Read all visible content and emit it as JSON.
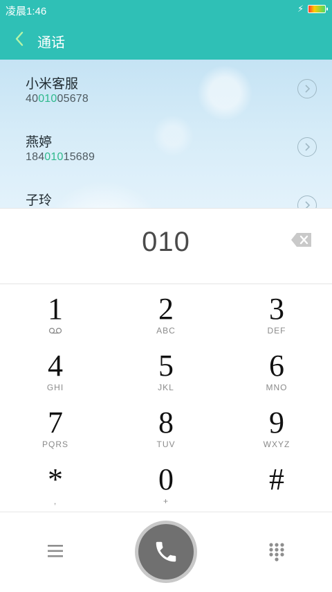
{
  "status": {
    "time": "凌晨1:46",
    "bolt": "⚡"
  },
  "header": {
    "title": "通话"
  },
  "contacts": [
    {
      "name": "小米客服",
      "num_pre": "40",
      "num_match": "010",
      "num_post": "05678"
    },
    {
      "name": "燕婷",
      "num_pre": "184",
      "num_match": "010",
      "num_post": "15689"
    },
    {
      "name": "子玲",
      "num_pre": "",
      "num_match": "",
      "num_post": ""
    }
  ],
  "dialer": {
    "entered": "010"
  },
  "keys": [
    {
      "digit": "1",
      "letters": ""
    },
    {
      "digit": "2",
      "letters": "ABC"
    },
    {
      "digit": "3",
      "letters": "DEF"
    },
    {
      "digit": "4",
      "letters": "GHI"
    },
    {
      "digit": "5",
      "letters": "JKL"
    },
    {
      "digit": "6",
      "letters": "MNO"
    },
    {
      "digit": "7",
      "letters": "PQRS"
    },
    {
      "digit": "8",
      "letters": "TUV"
    },
    {
      "digit": "9",
      "letters": "WXYZ"
    },
    {
      "digit": "*",
      "letters": ","
    },
    {
      "digit": "0",
      "letters": "+"
    },
    {
      "digit": "#",
      "letters": ""
    }
  ],
  "colors": {
    "accent": "#2fc0b6",
    "match": "#2fb98c",
    "call": "#707070"
  },
  "icons": {
    "back": "chevron-left-icon",
    "arrow": "chevron-right-circle-icon",
    "backspace": "backspace-icon",
    "voicemail": "voicemail-icon",
    "menu": "menu-icon",
    "call": "phone-icon",
    "keypad": "dialpad-icon"
  }
}
